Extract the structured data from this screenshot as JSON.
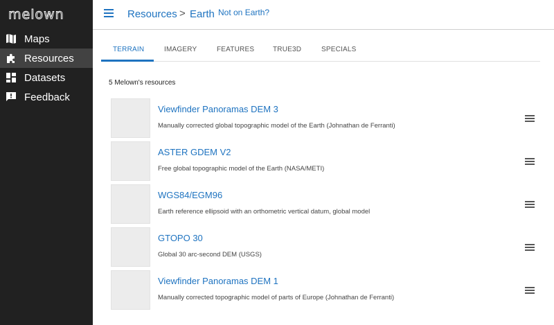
{
  "sidebar": {
    "logo_text": "melown",
    "items": [
      {
        "label": "Maps",
        "icon": "map-icon",
        "active": false
      },
      {
        "label": "Resources",
        "icon": "puzzle-icon",
        "active": true
      },
      {
        "label": "Datasets",
        "icon": "dashboard-icon",
        "active": false
      },
      {
        "label": "Feedback",
        "icon": "feedback-icon",
        "active": false
      }
    ]
  },
  "header": {
    "breadcrumb_1": "Resources",
    "separator": ">",
    "breadcrumb_2": "Earth",
    "not_on_earth": "Not on Earth?"
  },
  "tabs": [
    "TERRAIN",
    "IMAGERY",
    "FEATURES",
    "TRUE3D",
    "SPECIALS"
  ],
  "active_tab": "TERRAIN",
  "count_text": "5 Melown's resources",
  "resources": [
    {
      "title": "Viewfinder Panoramas DEM 3",
      "desc": "Manually corrected global topographic model of the Earth (Johnathan de Ferranti)"
    },
    {
      "title": "ASTER GDEM V2",
      "desc": "Free global topographic model of the Earth (NASA/METI)"
    },
    {
      "title": "WGS84/EGM96",
      "desc": "Earth reference ellipsoid with an orthometric vertical datum, global model"
    },
    {
      "title": "GTOPO 30",
      "desc": "Global 30 arc-second DEM (USGS)"
    },
    {
      "title": "Viewfinder Panoramas DEM 1",
      "desc": "Manually corrected topographic model of parts of Europe (Johnathan de Ferranti)"
    }
  ],
  "colors": {
    "accent": "#1e73c0",
    "sidebar_bg": "#212121",
    "sidebar_active": "#424242"
  }
}
